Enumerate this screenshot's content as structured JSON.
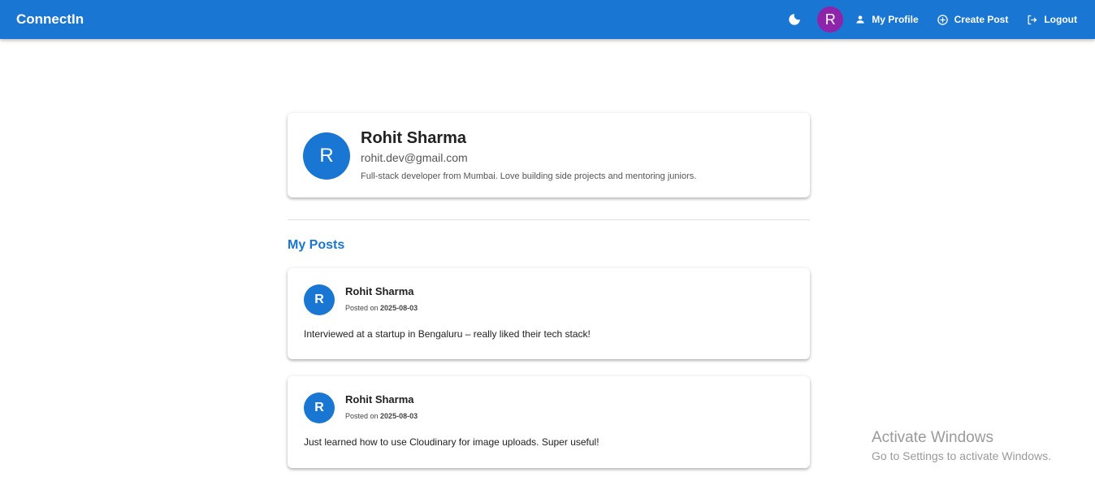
{
  "header": {
    "brand": "ConnectIn",
    "avatar_initial": "R",
    "my_profile": "My Profile",
    "create_post": "Create Post",
    "logout": "Logout"
  },
  "profile": {
    "initial": "R",
    "name": "Rohit Sharma",
    "email": "rohit.dev@gmail.com",
    "bio": "Full-stack developer from Mumbai. Love building side projects and mentoring juniors."
  },
  "posts_section": {
    "title": "My Posts",
    "posted_on_label": "Posted on",
    "posts": [
      {
        "initial": "R",
        "author": "Rohit Sharma",
        "date": "2025-08-03",
        "content": "Interviewed at a startup in Bengaluru – really liked their tech stack!"
      },
      {
        "initial": "R",
        "author": "Rohit Sharma",
        "date": "2025-08-03",
        "content": "Just learned how to use Cloudinary for image uploads. Super useful!"
      }
    ]
  },
  "watermark": {
    "title": "Activate Windows",
    "subtitle": "Go to Settings to activate Windows."
  },
  "colors": {
    "primary": "#1976d2",
    "nav_avatar": "#8e24aa"
  }
}
